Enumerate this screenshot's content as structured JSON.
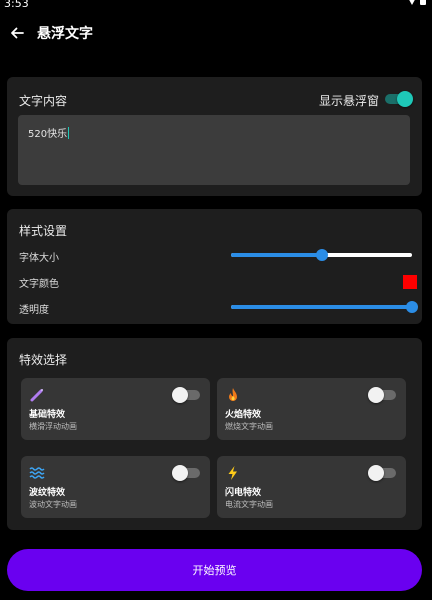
{
  "status_bar": {
    "time": "3:53"
  },
  "header": {
    "title": "悬浮文字"
  },
  "text_card": {
    "title": "文字内容",
    "show_window_label": "显示悬浮窗",
    "show_window_on": true,
    "text_value": "520快乐"
  },
  "style_card": {
    "title": "样式设置",
    "font_size_label": "字体大小",
    "font_size_fraction": 0.5,
    "text_color_label": "文字颜色",
    "text_color": "#ff0000",
    "opacity_label": "透明度",
    "opacity_fraction": 1.0
  },
  "effects_card": {
    "title": "特效选择",
    "items": [
      {
        "name": "基础特效",
        "desc": "横滑浮动动画",
        "icon": "magic-wand-icon",
        "on": false
      },
      {
        "name": "火焰特效",
        "desc": "燃烧文字动画",
        "icon": "fire-icon",
        "on": false
      },
      {
        "name": "波纹特效",
        "desc": "波动文字动画",
        "icon": "waves-icon",
        "on": false
      },
      {
        "name": "闪电特效",
        "desc": "电流文字动画",
        "icon": "lightning-icon",
        "on": false
      }
    ]
  },
  "preview_button": {
    "label": "开始预览"
  },
  "colors": {
    "accent": "#6a00f0",
    "switch_on": "#1ec8b8",
    "slider": "#2b8de6"
  }
}
